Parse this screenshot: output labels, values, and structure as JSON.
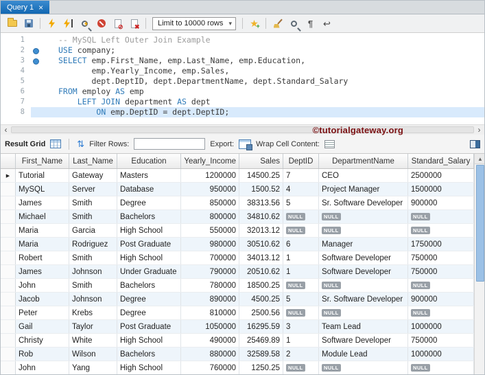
{
  "window": {
    "tab_title": "Query 1"
  },
  "toolbar": {
    "limit_dropdown": "Limit to 10000 rows",
    "icons": [
      "open-script",
      "save-script",
      "execute-sql",
      "execute-current-statement",
      "explain-plan",
      "stop-query",
      "toggle-stop-on-error",
      "rollback",
      "limit-rows-dropdown",
      "save-snippet",
      "beautify-sql",
      "find",
      "toggle-invisible-characters",
      "toggle-word-wrap"
    ]
  },
  "editor": {
    "lines": [
      {
        "num": "1",
        "dot": false,
        "highlight": false,
        "tokens": [
          {
            "t": "comment",
            "s": "-- MySQL Left Outer Join Example"
          }
        ]
      },
      {
        "num": "2",
        "dot": true,
        "highlight": false,
        "tokens": [
          {
            "t": "kw",
            "s": "USE"
          },
          {
            "t": "plain",
            "s": " company;"
          }
        ]
      },
      {
        "num": "3",
        "dot": true,
        "highlight": false,
        "tokens": [
          {
            "t": "kw",
            "s": "SELECT"
          },
          {
            "t": "plain",
            "s": " emp.First_Name, emp.Last_Name, emp.Education,"
          }
        ]
      },
      {
        "num": "4",
        "dot": false,
        "highlight": false,
        "tokens": [
          {
            "t": "plain",
            "s": "       emp.Yearly_Income, emp.Sales,"
          }
        ]
      },
      {
        "num": "5",
        "dot": false,
        "highlight": false,
        "tokens": [
          {
            "t": "plain",
            "s": "       dept.DeptID, dept.DepartmentName, dept.Standard_Salary"
          }
        ]
      },
      {
        "num": "6",
        "dot": false,
        "highlight": false,
        "tokens": [
          {
            "t": "kw",
            "s": "FROM"
          },
          {
            "t": "plain",
            "s": " employ "
          },
          {
            "t": "kw",
            "s": "AS"
          },
          {
            "t": "plain",
            "s": " emp"
          }
        ]
      },
      {
        "num": "7",
        "dot": false,
        "highlight": false,
        "tokens": [
          {
            "t": "plain",
            "s": "    "
          },
          {
            "t": "kw",
            "s": "LEFT JOIN"
          },
          {
            "t": "plain",
            "s": " department "
          },
          {
            "t": "kw",
            "s": "AS"
          },
          {
            "t": "plain",
            "s": " dept"
          }
        ]
      },
      {
        "num": "8",
        "dot": false,
        "highlight": true,
        "tokens": [
          {
            "t": "plain",
            "s": "        "
          },
          {
            "t": "kw",
            "s": "ON"
          },
          {
            "t": "plain",
            "s": " emp.DeptID = dept.DeptID;"
          }
        ]
      }
    ]
  },
  "watermark": "©tutorialgateway.org",
  "result_toolbar": {
    "grid_label": "Result Grid",
    "filter_label": "Filter Rows:",
    "filter_value": "",
    "export_label": "Export:",
    "wrap_label": "Wrap Cell Content:"
  },
  "grid": {
    "null_label": "NULL",
    "columns": [
      "First_Name",
      "Last_Name",
      "Education",
      "Yearly_Income",
      "Sales",
      "DeptID",
      "DepartmentName",
      "Standard_Salary"
    ],
    "rows": [
      [
        "Tutorial",
        "Gateway",
        "Masters",
        "1200000",
        "14500.25",
        "7",
        "CEO",
        "2500000"
      ],
      [
        "MySQL",
        "Server",
        "Database",
        "950000",
        "1500.52",
        "4",
        "Project Manager",
        "1500000"
      ],
      [
        "James",
        "Smith",
        "Degree",
        "850000",
        "38313.56",
        "5",
        "Sr. Software Developer",
        "900000"
      ],
      [
        "Michael",
        "Smith",
        "Bachelors",
        "800000",
        "34810.62",
        null,
        null,
        null
      ],
      [
        "Maria",
        "Garcia",
        "High School",
        "550000",
        "32013.12",
        null,
        null,
        null
      ],
      [
        "Maria",
        "Rodriguez",
        "Post Graduate",
        "980000",
        "30510.62",
        "6",
        "Manager",
        "1750000"
      ],
      [
        "Robert",
        "Smith",
        "High School",
        "700000",
        "34013.12",
        "1",
        "Software Developer",
        "750000"
      ],
      [
        "James",
        "Johnson",
        "Under Graduate",
        "790000",
        "20510.62",
        "1",
        "Software Developer",
        "750000"
      ],
      [
        "John",
        "Smith",
        "Bachelors",
        "780000",
        "18500.25",
        null,
        null,
        null
      ],
      [
        "Jacob",
        "Johnson",
        "Degree",
        "890000",
        "4500.25",
        "5",
        "Sr. Software Developer",
        "900000"
      ],
      [
        "Peter",
        "Krebs",
        "Degree",
        "810000",
        "2500.56",
        null,
        null,
        null
      ],
      [
        "Gail",
        "Taylor",
        "Post Graduate",
        "1050000",
        "16295.59",
        "3",
        "Team Lead",
        "1000000"
      ],
      [
        "Christy",
        "White",
        "High School",
        "490000",
        "25469.89",
        "1",
        "Software Developer",
        "750000"
      ],
      [
        "Rob",
        "Wilson",
        "Bachelors",
        "880000",
        "32589.58",
        "2",
        "Module Lead",
        "1000000"
      ],
      [
        "John",
        "Yang",
        "High School",
        "760000",
        "1250.25",
        null,
        null,
        null
      ]
    ]
  },
  "colors": {
    "tab_blue": "#1167b2",
    "keyword_blue": "#2e7ab8",
    "comment_gray": "#9b9b9b",
    "highlight_line": "#d8eafc",
    "watermark_red": "#7b1113",
    "null_badge_gray": "#99a0a7",
    "alt_row": "#eef5fb"
  }
}
